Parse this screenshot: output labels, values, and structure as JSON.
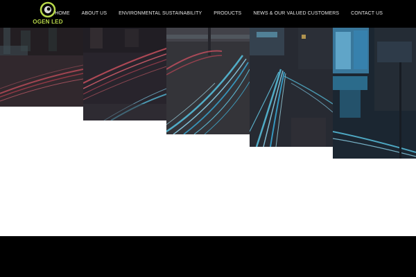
{
  "brand": {
    "logo_text": "OGEN LED",
    "logo_icon": "ogen-ring-logo-icon",
    "accent_color": "#b8d84a"
  },
  "nav": {
    "items": [
      {
        "label": "HOME"
      },
      {
        "label": "ABOUT US"
      },
      {
        "label": "ENVIRONMENTAL SUSTAINABILITY"
      },
      {
        "label": "PRODUCTS"
      },
      {
        "label": "NEWS & OUR VALUED CUSTOMERS"
      },
      {
        "label": "CONTACT US"
      }
    ]
  },
  "hero": {
    "image_description_icon": "city-light-trails-image",
    "colors": {
      "red_trail": "#e05a6a",
      "cyan_trail": "#5fd0f0",
      "dark_overlay": "#2a2630"
    }
  }
}
